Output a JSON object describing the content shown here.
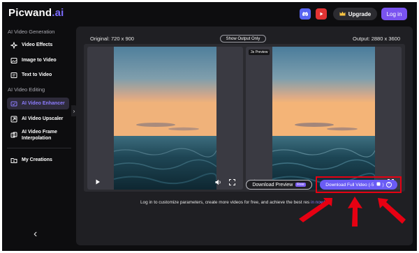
{
  "brand": {
    "name_main": "Picwand",
    "name_suffix": ".ai"
  },
  "header": {
    "upgrade_label": "Upgrade",
    "login_label": "Log in",
    "icons": [
      "discord-icon",
      "youtube-icon",
      "crown-icon"
    ]
  },
  "sidebar": {
    "section1": "AI Video Generation",
    "items1": [
      {
        "label": "Video Effects",
        "icon": "sparkle-icon"
      },
      {
        "label": "Image to Video",
        "icon": "image-icon"
      },
      {
        "label": "Text to Video",
        "icon": "text-icon"
      }
    ],
    "section2": "AI Video Editing",
    "items2": [
      {
        "label": "AI Video Enhancer",
        "icon": "enhance-icon",
        "active": true
      },
      {
        "label": "AI Video Upscaler",
        "icon": "upscale-icon"
      },
      {
        "label_line1": "AI Video Frame",
        "label_line2": "Interpolation",
        "icon": "frames-icon"
      }
    ],
    "my_creations": "My Creations"
  },
  "main": {
    "original_label": "Original: 720 x 900",
    "output_label": "Output: 2880 x 3600",
    "show_output_only": "Show Output Only",
    "preview_tag": "3s Preview",
    "download_preview": "Download Preview",
    "free_badge": "Free",
    "download_full": "Download Full Video (-5",
    "download_full_close": ")",
    "info_symbol": "?",
    "notice_text": "Log in to customize parameters, create more videos for free, and achieve the best res",
    "notice_link": "in now!"
  },
  "colors": {
    "accent": "#7a53f0",
    "highlight": "#e60012",
    "background": "#0d0d0f"
  }
}
